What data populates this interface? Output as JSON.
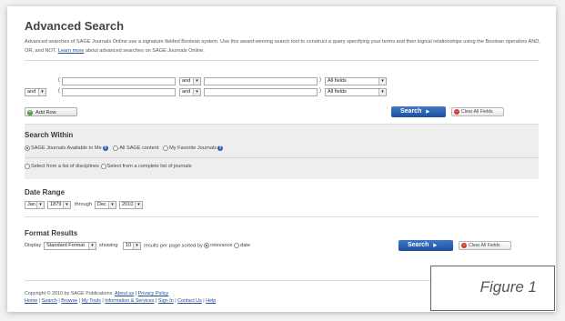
{
  "header": {
    "title": "Advanced Search",
    "desc_main": "Advanced searches of SAGE Journals Online use a signature fielded Boolean system. Use this award-winning search tool to construct a query specifying your terms and their logical relationships using the Boolean operators AND, OR, and NOT.",
    "desc_link": "Learn more",
    "desc_tail": "about advanced searches on SAGE Journals Online."
  },
  "query_rows": [
    {
      "row_op": "",
      "open_paren": "(",
      "term1": "",
      "op": "and",
      "term2": "",
      "close_paren": ")",
      "field": "All fields"
    },
    {
      "row_op": "and",
      "open_paren": "(",
      "term1": "",
      "op": "and",
      "term2": "",
      "close_paren": ")",
      "field": "All fields"
    }
  ],
  "add_row_label": "Add Row",
  "search_label": "Search",
  "clear_label": "Clear All Fields",
  "search_within": {
    "title": "Search Within",
    "options": [
      "SAGE Journals Available to Me",
      "All SAGE content",
      "My Favorite Journals"
    ],
    "selected": 0,
    "options2": [
      "Select from a list of disciplines",
      "Select from a complete list of journals"
    ]
  },
  "date_range": {
    "title": "Date Range",
    "from_month": "Jan",
    "from_year": "1879",
    "through_label": "through",
    "to_month": "Dec",
    "to_year": "2010"
  },
  "format_results": {
    "title": "Format Results",
    "display_label": "Display",
    "format_value": "Standard Format",
    "showing_label": "showing",
    "per_page": "10",
    "per_page_tail": "results per page sorted by",
    "sort_options": [
      "relevance",
      "date"
    ],
    "sort_selected": 0
  },
  "footer": {
    "copyright": "Copyright © 2010 by SAGE Publications",
    "top_links": [
      "About us",
      "Privacy Policy"
    ],
    "bottom_links": [
      "Home",
      "Search",
      "Browse",
      "My Tools",
      "Information & Services",
      "Sign In",
      "Contact Us",
      "Help"
    ]
  },
  "figure_caption": "Figure 1",
  "colors": {
    "accent": "#1f4f95",
    "button_blue": "#2a5fb0",
    "clear_red": "#d43c2f",
    "add_green": "#4a9a3a"
  }
}
